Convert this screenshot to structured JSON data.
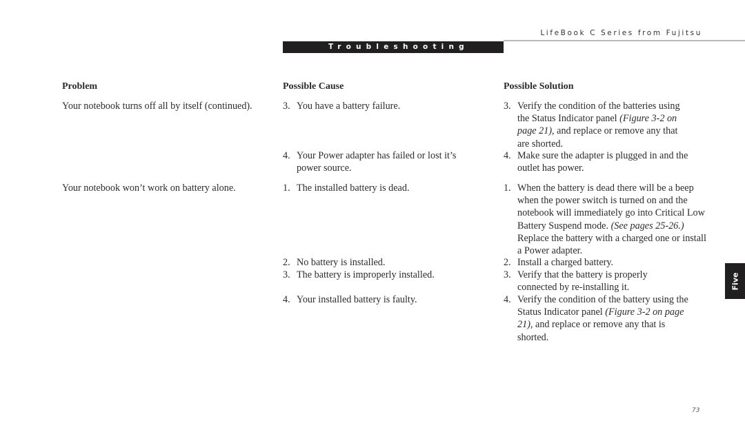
{
  "header": {
    "running_title": "LifeBook C Series from Fujitsu",
    "section": "Troubleshooting"
  },
  "columns": {
    "problem": "Problem",
    "cause": "Possible Cause",
    "solution": "Possible Solution"
  },
  "rows": [
    {
      "problem": "Your notebook turns off all by itself (continued).",
      "entries": [
        {
          "cause_num": "3.",
          "cause": "You have a battery failure.",
          "sol_num": "3.",
          "sol_parts": [
            "Verify the condition of the batteries using the Status Indicator panel ",
            "(Figure 3-2 on page 21)",
            ", and replace or remove any that are shorted."
          ]
        },
        {
          "cause_num": "4.",
          "cause": "Your Power adapter has failed or lost it’s power source.",
          "sol_num": "4.",
          "sol_parts": [
            "Make sure the adapter is plugged in and the outlet has power.",
            "",
            ""
          ]
        }
      ]
    },
    {
      "problem": "Your notebook won’t work on battery alone.",
      "entries": [
        {
          "cause_num": "1.",
          "cause": "The installed battery is dead.",
          "sol_num": "1.",
          "sol_parts": [
            "When the battery is dead there will be a beep when the power switch is turned on and the notebook will immediately go into Critical Low Battery Suspend mode. ",
            "(See pages 25-26.)",
            " Replace the battery with a charged one or install a Power adapter."
          ]
        },
        {
          "cause_num": "2.",
          "cause": "No battery is installed.",
          "sol_num": "2.",
          "sol_parts": [
            "Install a charged battery.",
            "",
            ""
          ]
        },
        {
          "cause_num": "3.",
          "cause": "The battery is improperly installed.",
          "sol_num": "3.",
          "sol_parts": [
            "Verify that the battery is properly connected by re-installing it.",
            "",
            ""
          ]
        },
        {
          "cause_num": "4.",
          "cause": "Your installed battery is faulty.",
          "sol_num": "4.",
          "sol_parts": [
            "Verify the condition of the battery using the Status Indicator panel ",
            "(Figure 3-2 on page 21)",
            ", and replace or remove any that is shorted."
          ]
        }
      ]
    }
  ],
  "chapter_tab": "Five",
  "page_number": "73"
}
